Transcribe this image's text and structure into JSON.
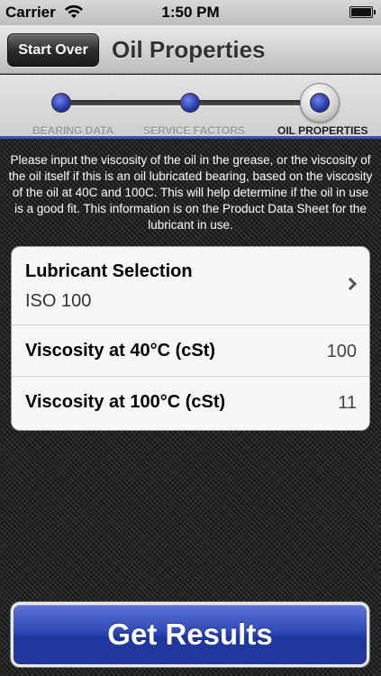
{
  "status_bar": {
    "carrier": "Carrier",
    "time": "1:50 PM"
  },
  "nav": {
    "back_label": "Start Over",
    "title": "Oil Properties"
  },
  "stepper": {
    "steps": [
      {
        "label": "BEARING DATA",
        "state": "completed"
      },
      {
        "label": "SERVICE FACTORS",
        "state": "completed"
      },
      {
        "label": "OIL PROPERTIES",
        "state": "current"
      }
    ]
  },
  "instructions": "Please input the viscosity of the oil in the grease, or the viscosity of the oil itself if this is an oil lubricated bearing, based on the viscosity of the oil at 40C and 100C. This will help determine if the oil in use is a good fit. This information is on the Product Data Sheet for the lubricant in use.",
  "table": {
    "lubricant": {
      "title": "Lubricant Selection",
      "value": "ISO 100"
    },
    "viscosity_40": {
      "label": "Viscosity at 40°C (cSt)",
      "value": "100"
    },
    "viscosity_100": {
      "label": "Viscosity at 100°C (cSt)",
      "value": "11"
    }
  },
  "actions": {
    "get_results_label": "Get Results"
  },
  "colors": {
    "accent_blue": "#2f49b8",
    "background": "#2b2b2b"
  }
}
